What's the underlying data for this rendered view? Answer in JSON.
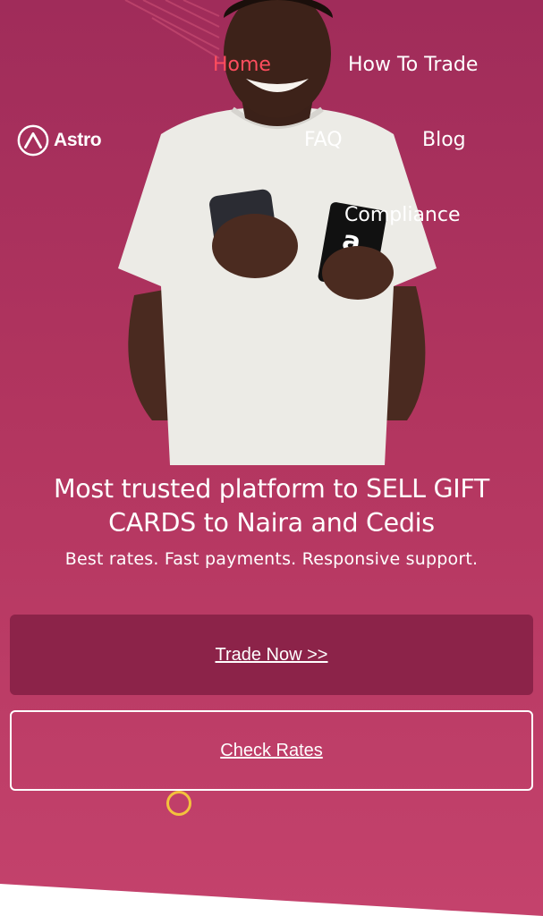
{
  "brand": {
    "name": "Astro",
    "logo_icon": "astro-logo-icon"
  },
  "nav": {
    "home": "Home",
    "how_to_trade": "How To Trade",
    "faq": "FAQ",
    "blog": "Blog",
    "compliance": "Compliance"
  },
  "hero": {
    "title_line1": "Most trusted platform to SELL GIFT",
    "title_line2": "CARDS to Naira and Cedis",
    "subtitle": "Best rates. Fast payments. Responsive support."
  },
  "buttons": {
    "trade_now": "Trade Now >>",
    "check_rates": "Check Rates"
  },
  "colors": {
    "background": "#b2355f",
    "active_nav": "#ff4d5e",
    "primary_button": "#8c2349",
    "cursor_ring": "#f3c23d"
  }
}
